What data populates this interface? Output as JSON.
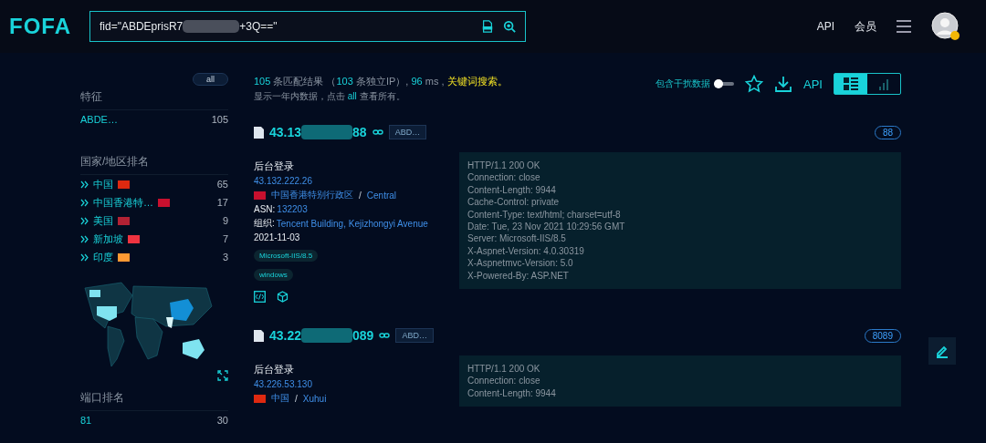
{
  "header": {
    "logo": "FOFA",
    "query_before": "fid=\"ABDEprisR7",
    "query_after": "+3Q==\"",
    "nav": [
      "API",
      "会员"
    ]
  },
  "sidebar": {
    "all_button": "all",
    "features": {
      "title": "特征",
      "items": [
        {
          "label": "ABDE…",
          "count": "105"
        }
      ]
    },
    "countries": {
      "title": "国家/地区排名",
      "items": [
        {
          "label": "中国",
          "count": "65",
          "color": "#de2910"
        },
        {
          "label": "中国香港特…",
          "count": "17",
          "color": "#c8102e"
        },
        {
          "label": "美国",
          "count": "9",
          "color": "#b22234"
        },
        {
          "label": "新加坡",
          "count": "7",
          "color": "#ef3340"
        },
        {
          "label": "印度",
          "count": "3",
          "color": "#ff9933"
        }
      ]
    },
    "ports": {
      "title": "端口排名",
      "items": [
        {
          "label": "81",
          "count": "30"
        }
      ]
    }
  },
  "summary": {
    "line1": [
      {
        "kind": "num",
        "text": "105"
      },
      {
        "kind": "text",
        "text": " 条匹配结果 （"
      },
      {
        "kind": "num",
        "text": "103"
      },
      {
        "kind": "text",
        "text": " 条独立IP）, "
      },
      {
        "kind": "num",
        "text": "96"
      },
      {
        "kind": "text",
        "text": " ms , "
      },
      {
        "kind": "link",
        "text": "关键词搜索。"
      }
    ],
    "line2": [
      {
        "kind": "text",
        "text": "显示一年内数据，点击 "
      },
      {
        "kind": "link2",
        "text": "all"
      },
      {
        "kind": "text",
        "text": " 查看所有。"
      }
    ]
  },
  "toolbar": {
    "toggle_label": "包含干扰数据",
    "toggle_on": false,
    "api": "API",
    "views": [
      {
        "selected": true
      },
      {
        "selected": false
      }
    ]
  },
  "results": [
    {
      "ip_before": "43.13",
      "ip_after": "88",
      "tag": "ABD…",
      "port": "88",
      "title": "后台登录",
      "host": "43.132.222.26",
      "color": "#c8102e",
      "country": "中国香港特别行政区",
      "sep": "/",
      "city": "Central",
      "asn_label": "ASN:",
      "asn": "132203",
      "org_label": "组织:",
      "org": "Tencent Building, Kejizhongyi Avenue",
      "date": "2021-11-03",
      "products": [
        "Microsoft-IIS/8.5",
        "windows"
      ],
      "headers": [
        "HTTP/1.1 200 OK",
        "Connection: close",
        "Content-Length: 9944",
        "Cache-Control: private",
        "Content-Type: text/html; charset=utf-8",
        "Date: Tue, 23 Nov 2021 10:29:56 GMT",
        "Server: Microsoft-IIS/8.5",
        "X-Aspnet-Version: 4.0.30319",
        "X-Aspnetmvc-Version: 5.0",
        "X-Powered-By: ASP.NET"
      ]
    },
    {
      "ip_before": "43.22",
      "ip_after": "089",
      "tag": "ABD…",
      "port": "8089",
      "title": "后台登录",
      "host": "43.226.53.130",
      "color": "#de2910",
      "country": "中国",
      "sep": "/",
      "city": "Xuhui",
      "headers": [
        "HTTP/1.1 200 OK",
        "Connection: close",
        "Content-Length: 9944"
      ]
    }
  ]
}
